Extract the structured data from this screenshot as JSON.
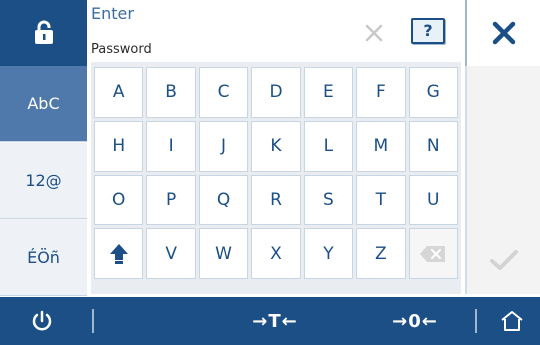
{
  "header": {
    "prompt_line1": "Enter",
    "input_placeholder": "Password",
    "help_label": "?",
    "icons": {
      "lock": "lock-icon",
      "clear": "clear-x-icon",
      "close": "close-icon"
    }
  },
  "modes": [
    {
      "label": "AbC",
      "active": true
    },
    {
      "label": "12@",
      "active": false
    },
    {
      "label": "ÉÖñ",
      "active": false
    }
  ],
  "keyboard": {
    "rows": [
      [
        "A",
        "B",
        "C",
        "D",
        "E",
        "F",
        "G"
      ],
      [
        "H",
        "I",
        "J",
        "K",
        "L",
        "M",
        "N"
      ],
      [
        "O",
        "P",
        "Q",
        "R",
        "S",
        "T",
        "U"
      ],
      [
        "SHIFT",
        "V",
        "W",
        "X",
        "Y",
        "Z",
        "BACKSPACE"
      ]
    ]
  },
  "bottom_bar": {
    "tare_label": "→T←",
    "zero_label": "→0←",
    "icons": {
      "power": "power-icon",
      "home": "home-icon"
    }
  },
  "colors": {
    "primary": "#1b4f86",
    "active_mode": "#4f78ab",
    "light": "#e9edf2"
  }
}
